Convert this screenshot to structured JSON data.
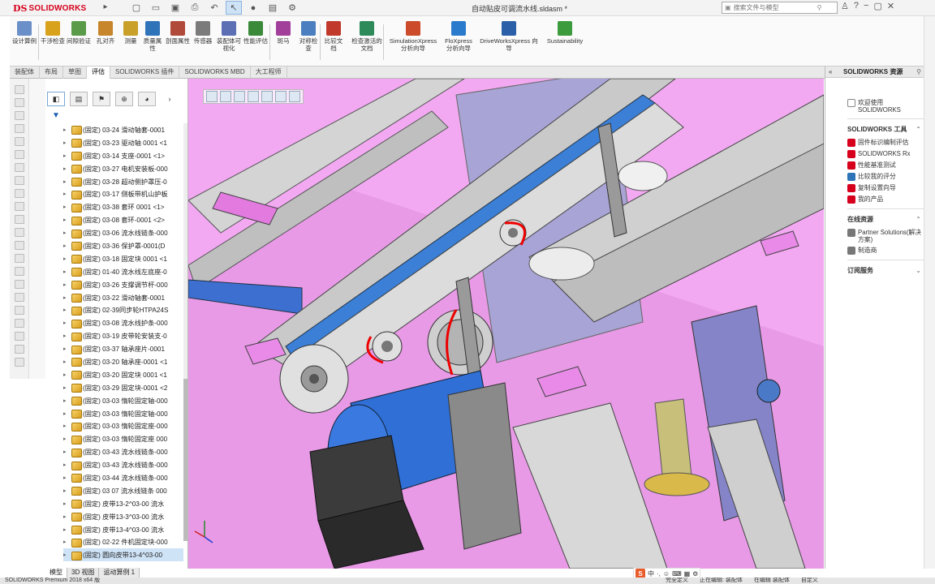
{
  "titlebar": {
    "logo_mark": "DS",
    "logo_text": "SOLIDWORKS",
    "doc_title": "自动贴皮可调流水线.sldasm *",
    "search_placeholder": "搜索文件与模型",
    "quick_icons": [
      "new-file-icon",
      "open-file-icon",
      "save-icon",
      "print-icon",
      "undo-icon",
      "select-icon",
      "rebuild-icon",
      "file-properties-icon",
      "options-icon"
    ],
    "window_icons": [
      "user-icon",
      "help-icon",
      "minimize-icon",
      "restore-icon",
      "close-icon"
    ]
  },
  "command_manager": {
    "commands": [
      {
        "label": "设计算例",
        "icon": "design-study-icon",
        "color": "#6b8fc9"
      },
      {
        "label": "干涉检查",
        "icon": "interference-icon",
        "color": "#d9a21c"
      },
      {
        "label": "间隙验证",
        "icon": "clearance-icon",
        "color": "#5a9b4a"
      },
      {
        "label": "孔对齐",
        "icon": "hole-align-icon",
        "color": "#c7862b"
      },
      {
        "label": "测量",
        "icon": "measure-icon",
        "color": "#c9a12a"
      },
      {
        "label": "质量属性",
        "icon": "mass-properties-icon",
        "color": "#2f73b8"
      },
      {
        "label": "剖面属性",
        "icon": "section-properties-icon",
        "color": "#b04a3a"
      },
      {
        "label": "传感器",
        "icon": "sensor-icon",
        "color": "#7b7b7b"
      },
      {
        "label": "装配体可视化",
        "icon": "assembly-visualization-icon",
        "color": "#5c6fb5"
      },
      {
        "label": "性能评估",
        "icon": "performance-icon",
        "color": "#3a8a3a"
      },
      {
        "label": "斑马",
        "icon": "zebra-icon",
        "color": "#a23f9b"
      },
      {
        "label": "对称检查",
        "icon": "symmetry-icon",
        "color": "#4c7fbf"
      },
      {
        "label": "比较文档",
        "icon": "compare-icon",
        "color": "#c0392b"
      },
      {
        "label": "检查激活的文档",
        "icon": "check-document-icon",
        "color": "#2f8a5a"
      },
      {
        "label": "SimulationXpress 分析向导",
        "icon": "simulationxpress-icon",
        "color": "#cc4b2b"
      },
      {
        "label": "FloXpress 分析向导",
        "icon": "floxpress-icon",
        "color": "#2b7bcc"
      },
      {
        "label": "DriveWorksXpress 向导",
        "icon": "driveworks-icon",
        "color": "#2b5fa8"
      },
      {
        "label": "Sustainability",
        "icon": "sustainability-icon",
        "color": "#3c9b3c"
      }
    ]
  },
  "tabs": [
    "装配体",
    "布局",
    "草图",
    "评估",
    "SOLIDWORKS 插件",
    "SOLIDWORKS MBD",
    "大工程师"
  ],
  "active_tab": "评估",
  "feature_tree": {
    "panel_icons": [
      "feature-manager-icon",
      "property-manager-icon",
      "configuration-manager-icon",
      "dimxpert-icon",
      "display-manager-icon"
    ],
    "rows": [
      "(固定) 03-24 滑动轴套-0001",
      "(固定) 03-23 驱动轴 0001 <1",
      "(固定) 03-14 支座-0001 <1>",
      "(固定) 03-27 电机安装板-000",
      "(固定) 03-28 超动侧护罩压-0",
      "(固定) 03-17 侧板带机山护板",
      "(固定) 03-38 套环 0001 <1>",
      "(固定) 03-08 套环-0001 <2>",
      "(固定) 03-06 流水线链条-000",
      "(固定) 03-36 保护罩-0001(D",
      "(固定) 03-18 固定块 0001 <1",
      "(固定) 01-40 流水线左底座-0",
      "(固定) 03-26 支撑调节杆-000",
      "(固定) 03-22 滑动轴套-0001",
      "(固定) 02-39同步轮HTPA24S",
      "(固定) 03-08 流水线护条-000",
      "(固定) 03-19 皮带轮安装支-0",
      "(固定) 03-37 轴承座片-0001",
      "(固定) 03-20 轴承座-0001 <1",
      "(固定) 03-20 固定块 0001 <1",
      "(固定) 03-29 固定块-0001 <2",
      "(固定) 03-03 惰轮固定轴-000",
      "(固定) 03-03 惰轮固定轴-000",
      "(固定) 03-03 惰轮固定座-000",
      "(固定) 03-03 惰轮固定座 000",
      "(固定) 03-43 流水线链条-000",
      "(固定) 03-43 流水线链条-000",
      "(固定) 03-44 流水线链条-000",
      "(固定) 03 07 流水线链条 000",
      "(固定) 皮带13-2^03-00 流水",
      "(固定) 皮带13-3^03-00 流水",
      "(固定) 皮带13-4^03-00 流水",
      "(固定) 02-22 件机固定块-000",
      "(固定) 圆向皮带13-4^03-00"
    ],
    "selected_index": 33,
    "bottom_tabs": [
      "模型",
      "3D 视图",
      "运动算例 1"
    ],
    "active_bottom_tab": "模型"
  },
  "viewport": {
    "background": "#f2a9f2",
    "hud_icons": [
      "zoom-fit-icon",
      "zoom-area-icon",
      "previous-view-icon",
      "section-view-icon",
      "view-orientation-icon",
      "display-style-icon",
      "hide-show-icon"
    ]
  },
  "task_pane": {
    "title": "SOLIDWORKS 资源",
    "welcome": "欢迎使用 SOLIDWORKS",
    "tools_title": "SOLIDWORKS 工具",
    "tools": [
      {
        "label": "固件标识编制评估",
        "color": "#d6001c"
      },
      {
        "label": "SOLIDWORKS Rx",
        "color": "#d6001c"
      },
      {
        "label": "性能基准测试",
        "color": "#d6001c"
      },
      {
        "label": "比较我的评分",
        "color": "#2f73b8"
      },
      {
        "label": "复制设置向导",
        "color": "#d6001c"
      },
      {
        "label": "我的产品",
        "color": "#d6001c"
      }
    ],
    "online_title": "在线资源",
    "online": [
      {
        "label": "Partner Solutions(解决方案)"
      },
      {
        "label": "制造商"
      }
    ],
    "subscription_title": "订阅服务"
  },
  "statusbar": {
    "left": "SOLIDWORKS Premium 2018 x64 版",
    "right": [
      "完全定义",
      "正在编辑: 装配体",
      "在编辑 装配体",
      "自定义"
    ]
  },
  "ime": {
    "logo": "S",
    "items": [
      "中",
      "·,",
      "☺",
      "⌨",
      "▦",
      "⚙"
    ]
  }
}
